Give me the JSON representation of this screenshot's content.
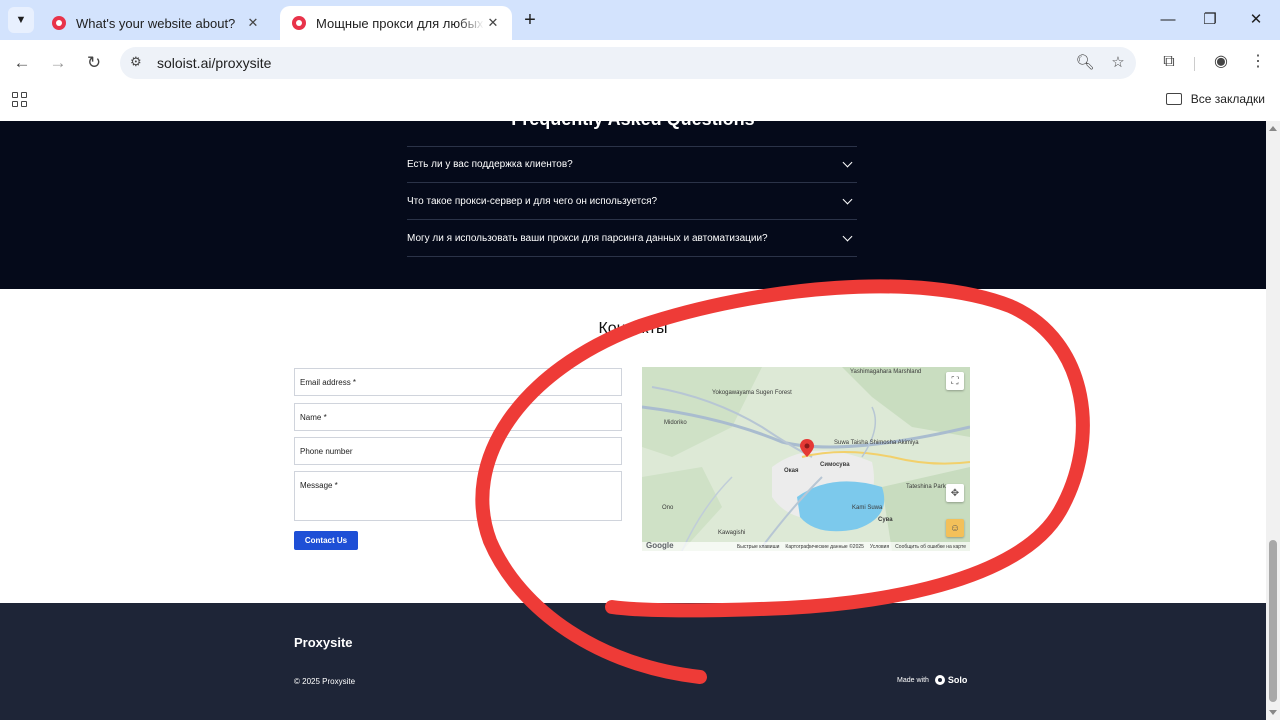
{
  "browser": {
    "tabs": [
      {
        "title": "What's your website about?",
        "active": false
      },
      {
        "title": "Мощные прокси для любых задач",
        "active": true
      }
    ],
    "url": "soloist.ai/proxysite",
    "bookmarks_label": "Все закладки"
  },
  "faq": {
    "title": "Frequently Asked Questions",
    "items": [
      "Есть ли у вас поддержка клиентов?",
      "Что такое прокси-сервер и для чего он используется?",
      "Могу ли я использовать ваши прокси для парсинга данных и автоматизации?"
    ]
  },
  "contacts": {
    "title": "Контакты",
    "email_label": "Email address *",
    "name_label": "Name *",
    "phone_label": "Phone number",
    "message_label": "Message *",
    "submit_label": "Contact Us"
  },
  "map": {
    "labels": [
      "Yashimagahara Marshland",
      "Yokogawayama Sugen Forest",
      "Midoriko",
      "Suwa Taisha Shimosha Akimiya",
      "Окая",
      "Симосува",
      "Tateshina Park",
      "Kami Suwa",
      "Сува",
      "Kawagishi",
      "Ono"
    ],
    "logo": "Google",
    "footer": [
      "Быстрые клавиши",
      "Картографические данные ©2025",
      "Условия",
      "Сообщить об ошибке на карте"
    ]
  },
  "footer": {
    "brand": "Proxysite",
    "copyright": "© 2025 Proxysite",
    "made_with": "Made with",
    "made_by": "Solo"
  },
  "colors": {
    "faq_bg": "#050a1a",
    "footer_bg": "#1e2537",
    "button_blue": "#1e4fd6",
    "annotation_red": "#ee3b37",
    "tab_strip": "#d3e3fd"
  }
}
